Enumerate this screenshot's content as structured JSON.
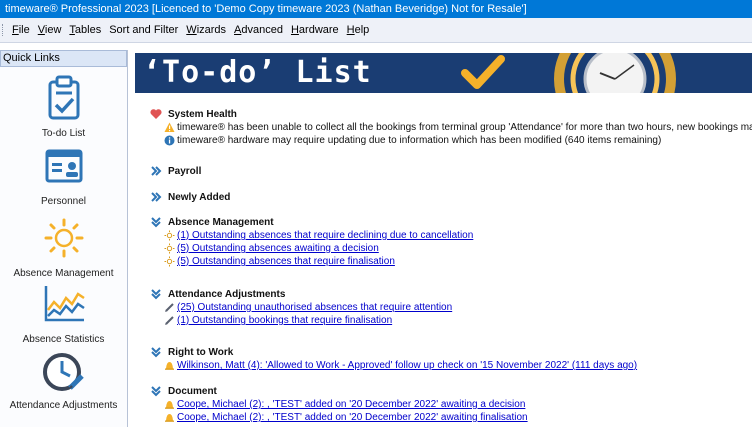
{
  "window": {
    "title": "timeware® Professional 2023 [Licenced to 'Demo Copy timeware 2023 (Nathan Beveridge) Not for Resale']"
  },
  "menu": {
    "items": [
      {
        "pre": "",
        "key": "F",
        "post": "ile"
      },
      {
        "pre": "",
        "key": "V",
        "post": "iew"
      },
      {
        "pre": "",
        "key": "T",
        "post": "ables"
      },
      {
        "pre": "Sort and Filter",
        "key": "",
        "post": ""
      },
      {
        "pre": "",
        "key": "W",
        "post": "izards"
      },
      {
        "pre": "",
        "key": "A",
        "post": "dvanced"
      },
      {
        "pre": "",
        "key": "H",
        "post": "ardware"
      },
      {
        "pre": "",
        "key": "H",
        "post": "elp"
      }
    ]
  },
  "sidebar": {
    "header": "Quick Links",
    "items": [
      {
        "label": "To-do List",
        "icon": "clipboard-check-icon"
      },
      {
        "label": "Personnel",
        "icon": "id-card-icon"
      },
      {
        "label": "Absence Management",
        "icon": "sun-icon"
      },
      {
        "label": "Absence Statistics",
        "icon": "line-graph-icon"
      },
      {
        "label": "Attendance Adjustments",
        "icon": "clock-pencil-icon"
      }
    ]
  },
  "banner": {
    "title": "‘To-do’ List",
    "accent_color": "#f5b12a",
    "background_color": "#1a3d73"
  },
  "sections": {
    "system_health": {
      "title": "System Health",
      "icon": "heart-icon",
      "items": [
        {
          "icon": "warning-icon",
          "text": "timeware® has been unable to collect all the bookings from terminal group 'Attendance' for more than two hours, new bookings may not calculate until this is resolved."
        },
        {
          "icon": "info-icon",
          "text": "timeware® hardware may require updating due to information which has been modified (640 items remaining)"
        }
      ]
    },
    "payroll": {
      "title": "Payroll",
      "icon": "double-chevron-right-icon"
    },
    "newly_added": {
      "title": "Newly Added",
      "icon": "double-chevron-right-icon"
    },
    "absence_management": {
      "title": "Absence Management",
      "icon": "double-chevron-down-icon",
      "items": [
        {
          "icon": "sun-icon",
          "text": "(1) Outstanding absences that require declining due to cancellation"
        },
        {
          "icon": "sun-icon",
          "text": "(5) Outstanding absences awaiting a decision"
        },
        {
          "icon": "sun-icon",
          "text": "(5) Outstanding absences that require finalisation"
        }
      ]
    },
    "attendance_adjustments": {
      "title": "Attendance Adjustments",
      "icon": "double-chevron-down-icon",
      "items": [
        {
          "icon": "pencil-icon",
          "text": "(25) Outstanding unauthorised absences that require attention"
        },
        {
          "icon": "pencil-icon",
          "text": "(1) Outstanding bookings that require finalisation"
        }
      ]
    },
    "right_to_work": {
      "title": "Right to Work",
      "icon": "double-chevron-down-icon",
      "items": [
        {
          "icon": "bell-icon",
          "text": "Wilkinson, Matt (4): 'Allowed to Work - Approved' follow up check on '15 November 2022' (111 days ago)"
        }
      ]
    },
    "document": {
      "title": "Document",
      "icon": "double-chevron-down-icon",
      "items": [
        {
          "icon": "bell-icon",
          "text": "Coope, Michael (2): , 'TEST' added on '20 December 2022' awaiting a decision"
        },
        {
          "icon": "bell-icon",
          "text": "Coope, Michael (2): , 'TEST' added on '20 December 2022' awaiting finalisation"
        }
      ]
    }
  }
}
